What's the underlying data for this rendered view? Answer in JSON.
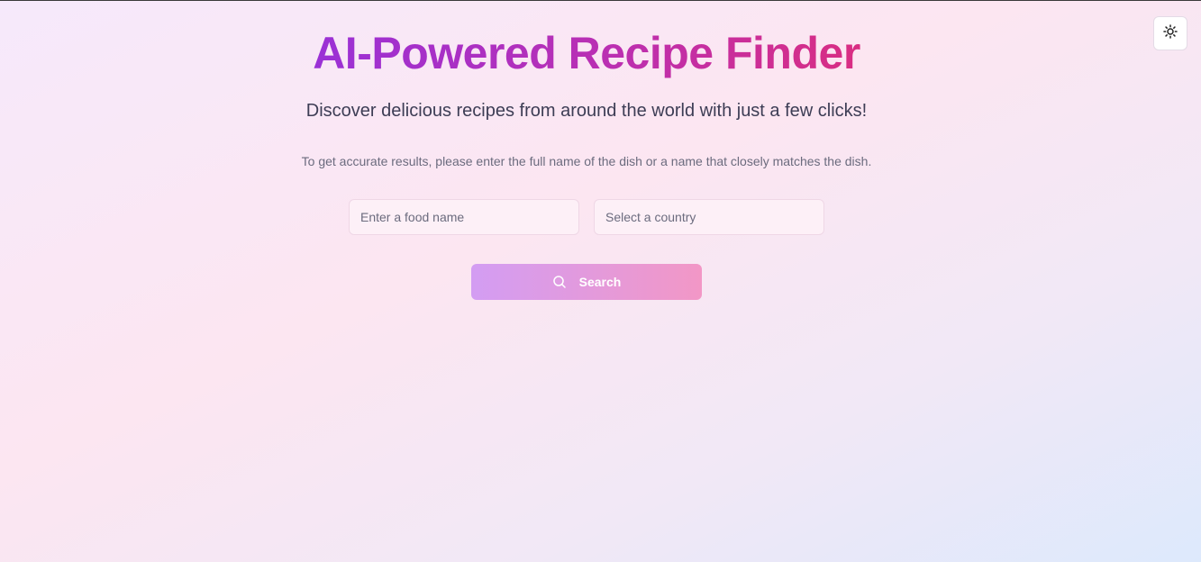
{
  "header": {
    "title": "AI-Powered Recipe Finder",
    "subtitle": "Discover delicious recipes from around the world with just a few clicks!",
    "hint": "To get accurate results, please enter the full name of the dish or a name that closely matches the dish."
  },
  "form": {
    "food_input": {
      "value": "",
      "placeholder": "Enter a food name"
    },
    "country_select": {
      "selected": "Select a country"
    },
    "search_button": {
      "label": "Search",
      "icon": "search-icon"
    }
  },
  "theme_toggle": {
    "icon": "sun-icon"
  },
  "colors": {
    "title_gradient_start": "#9a31d6",
    "title_gradient_end": "#d92d82",
    "button_gradient_start": "#d39df3",
    "button_gradient_end": "#f297c6"
  }
}
